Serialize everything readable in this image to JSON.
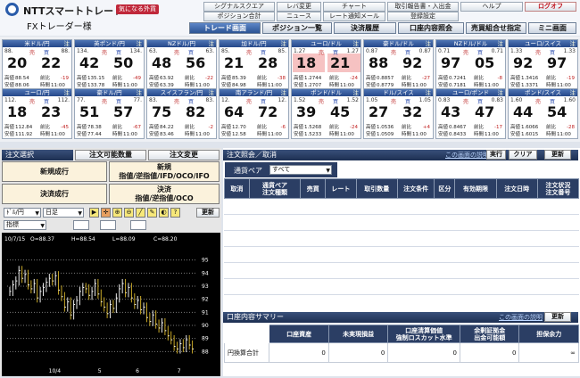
{
  "header": {
    "logo_text": "NTTスマートトレード",
    "logo_badge": "気になる外貨",
    "title": "FXトレーダー様"
  },
  "top_links": [
    {
      "label": "シグナルスクエア"
    },
    {
      "label": "レバ変更"
    },
    {
      "label": "チャート"
    },
    {
      "label": "取引報告書・入出金"
    },
    {
      "label": "ヘルプ"
    },
    {
      "label": "ログオフ"
    },
    {
      "label": "ポジション合計"
    },
    {
      "label": "ニュース"
    },
    {
      "label": "レート通知メール"
    },
    {
      "label": "登録設定"
    }
  ],
  "nav_tabs": [
    {
      "label": "トレード画面"
    },
    {
      "label": "ポジション一覧"
    },
    {
      "label": "決済履歴"
    },
    {
      "label": "口座内容照会"
    },
    {
      "label": "売買組合せ指定"
    },
    {
      "label": "ミニ画面"
    }
  ],
  "labels": {
    "sell": "売",
    "buy": "買",
    "high": "高値",
    "low": "安値",
    "diff": "前比",
    "time": "時間"
  },
  "pairs_row1": [
    {
      "name": "米ドル/円",
      "status": "注",
      "sell_pre": "88.",
      "buy_pre": "88.",
      "sell_big": "20",
      "buy_big": "22",
      "high": "88.54",
      "low": "88.06",
      "change": "-19",
      "time": "11:00",
      "highlight": false
    },
    {
      "name": "英ポンド/円",
      "status": "注",
      "sell_pre": "134.",
      "buy_pre": "134.",
      "sell_big": "42",
      "buy_big": "50",
      "high": "135.15",
      "low": "133.78",
      "change": "-49",
      "time": "11:00",
      "highlight": false
    },
    {
      "name": "NZドル/円",
      "status": "注",
      "sell_pre": "63.",
      "buy_pre": "63.",
      "sell_big": "48",
      "buy_big": "56",
      "high": "63.92",
      "low": "63.39",
      "change": "-22",
      "time": "11:00",
      "highlight": false
    },
    {
      "name": "加ドル/円",
      "status": "注",
      "sell_pre": "85.",
      "buy_pre": "85.",
      "sell_big": "21",
      "buy_big": "28",
      "high": "85.39",
      "low": "84.98",
      "change": "-38",
      "time": "11:00",
      "highlight": false
    },
    {
      "name": "ユーロ/ドル",
      "status": "注",
      "sell_pre": "1.27",
      "buy_pre": "1.27",
      "sell_big": "18",
      "buy_big": "21",
      "high": "1.2744",
      "low": "1.2707",
      "change": "-24",
      "time": "11:00",
      "highlight": true
    },
    {
      "name": "豪ドル/ドル",
      "status": "注",
      "sell_pre": "0.87",
      "buy_pre": "0.87",
      "sell_big": "88",
      "buy_big": "92",
      "high": "0.8857",
      "low": "0.8779",
      "change": "-27",
      "time": "11:00",
      "highlight": false
    },
    {
      "name": "NZドル/ドル",
      "status": "注",
      "sell_pre": "0.71",
      "buy_pre": "0.71",
      "sell_big": "97",
      "buy_big": "05",
      "high": "0.7241",
      "low": "0.7181",
      "change": "-8",
      "time": "11:00",
      "highlight": false
    },
    {
      "name": "ユーロ/スイス",
      "status": "注",
      "sell_pre": "1.33",
      "buy_pre": "1.33",
      "sell_big": "92",
      "buy_big": "97",
      "high": "1.3416",
      "low": "1.3371",
      "change": "-19",
      "time": "11:00",
      "highlight": false
    }
  ],
  "pairs_row2": [
    {
      "name": "ユーロ/円",
      "status": "注",
      "sell_pre": "112.",
      "buy_pre": "112.",
      "sell_big": "18",
      "buy_big": "23",
      "high": "112.84",
      "low": "111.92",
      "change": "-45",
      "time": "11:00",
      "highlight": false
    },
    {
      "name": "豪ドル/円",
      "status": "注",
      "sell_pre": "77.",
      "buy_pre": "77.",
      "sell_big": "51",
      "buy_big": "57",
      "high": "78.38",
      "low": "77.44",
      "change": "-67",
      "time": "11:00",
      "highlight": false
    },
    {
      "name": "スイスフラン/円",
      "status": "注",
      "sell_pre": "83.",
      "buy_pre": "83.",
      "sell_big": "75",
      "buy_big": "82",
      "high": "84.22",
      "low": "83.46",
      "change": "-2",
      "time": "11:00",
      "highlight": false
    },
    {
      "name": "南アランド/円",
      "status": "注",
      "sell_pre": "12.",
      "buy_pre": "12.",
      "sell_big": "64",
      "buy_big": "72",
      "high": "12.70",
      "low": "12.58",
      "change": "-6",
      "time": "11:00",
      "highlight": false
    },
    {
      "name": "ポンド/ドル",
      "status": "注",
      "sell_pre": "1.52",
      "buy_pre": "1.52",
      "sell_big": "39",
      "buy_big": "45",
      "high": "1.5268",
      "low": "1.5233",
      "change": "-24",
      "time": "11:00",
      "highlight": false
    },
    {
      "name": "ドル/スイス",
      "status": "注",
      "sell_pre": "1.05",
      "buy_pre": "1.05",
      "sell_big": "27",
      "buy_big": "32",
      "high": "1.0536",
      "low": "1.0509",
      "change": "+4",
      "time": "11:00",
      "highlight": false
    },
    {
      "name": "ユーロ/ポンド",
      "status": "注",
      "sell_pre": "0.83",
      "buy_pre": "0.83",
      "sell_big": "43",
      "buy_big": "47",
      "high": "0.8467",
      "low": "0.8433",
      "change": "-17",
      "time": "11:00",
      "highlight": false
    },
    {
      "name": "ポンド/スイス",
      "status": "注",
      "sell_pre": "1.60",
      "buy_pre": "1.60",
      "sell_big": "44",
      "buy_big": "54",
      "high": "1.6066",
      "low": "1.6015",
      "change": "-28",
      "time": "11:00",
      "highlight": false
    }
  ],
  "order_panel": {
    "title": "注文選択",
    "capacity_btn": "注文可能数量",
    "change_btn": "注文変更",
    "new_market": "新規成行",
    "new_limit_line1": "新規",
    "new_limit_line2": "指値/逆指値/IFD/OCO/IFO",
    "close_market": "決済成行",
    "close_limit_line1": "決済",
    "close_limit_line2": "指値/逆指値/OCO"
  },
  "chart_controls": {
    "pair": "ﾄﾞﾙ/円",
    "period": "日足",
    "indicator": "指標",
    "update": "更新"
  },
  "chart_data": {
    "type": "candlestick",
    "info_date": "10/7/15",
    "info_o": "O=88.37",
    "info_h": "H=88.54",
    "info_l": "L=88.09",
    "info_c": "C=88.20",
    "ylim": [
      87,
      96
    ],
    "yticks": [
      "95",
      "94",
      "93",
      "92",
      "91",
      "90",
      "89",
      "88"
    ],
    "xticks": [
      "10/4",
      "5",
      "6",
      "7"
    ],
    "colors": {
      "up": "#e8e8e8",
      "down": "#c8a828",
      "grid": "#7a7a7a"
    },
    "closes": [
      92.6,
      93.1,
      93.4,
      94.2,
      93.6,
      93.9,
      93.1,
      92.8,
      93.2,
      92.1,
      92.6,
      92.9,
      93.3,
      93.6,
      93.4,
      93.8,
      92.7,
      92.2,
      91.4,
      91.8,
      90.8,
      91.6,
      91.9,
      92.6,
      92.9,
      92.8,
      92.3,
      92.6,
      93.2,
      92.4,
      91.8,
      91.4,
      90.9,
      91.6,
      91.3,
      92.1,
      92.8,
      93.2,
      92.5,
      92.9,
      92.1,
      91.6,
      91.9,
      91.2,
      91.4,
      90.6,
      90.3,
      90.8,
      90.1,
      89.8,
      90.2,
      89.6,
      89.2,
      88.9,
      88.4,
      88.2,
      88.6,
      88.3,
      88.9,
      88.5,
      88.2
    ]
  },
  "orders": {
    "title": "注文照会／取消",
    "help_link": "この画面の説明",
    "exec_btn": "実行",
    "clear_btn": "クリア",
    "update_btn": "更新",
    "pair_label": "通貨ペア",
    "pair_value": "すべて",
    "columns": [
      "取消",
      "通貨ペア\n注文種類",
      "売買",
      "レート",
      "取引数量",
      "注文条件",
      "区分",
      "有効期限",
      "注文日時",
      "注文状況\n注文番号"
    ]
  },
  "summary": {
    "title": "口座内容サマリー",
    "help_link": "この画面の説明",
    "update_btn": "更新",
    "columns": [
      "口座資産",
      "未実現損益",
      "口座清算価値\n強制ロスカット水準",
      "余剰証拠金\n出金可能額",
      "担保余力"
    ],
    "row_label": "円換算合計",
    "values": [
      "0",
      "0",
      "0",
      "0",
      "∞"
    ]
  }
}
